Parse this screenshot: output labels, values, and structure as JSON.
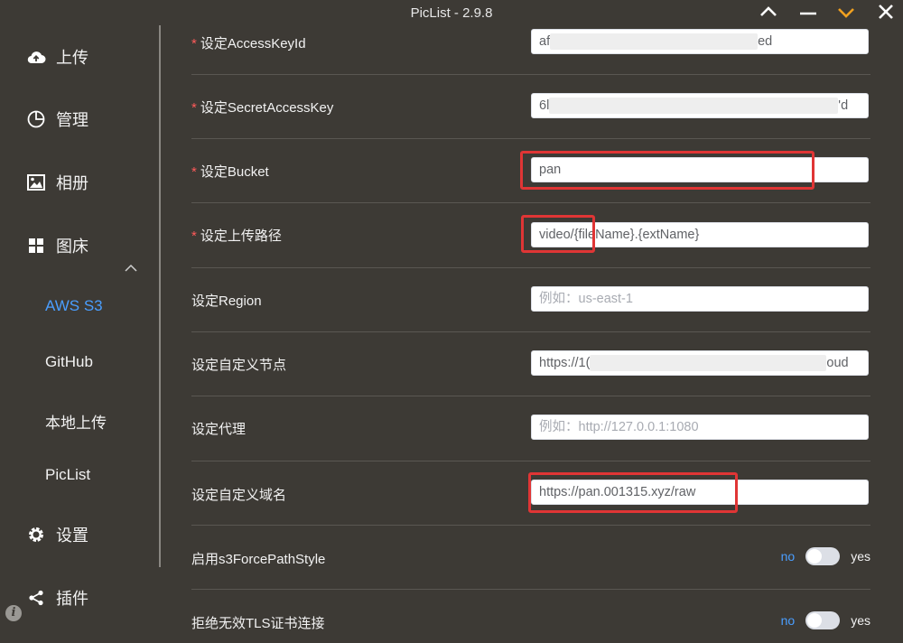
{
  "window": {
    "title": "PicList - 2.9.8",
    "accent_color": "#f0a020"
  },
  "sidebar": {
    "items": [
      {
        "label": "上传",
        "icon": "cloud-upload-icon"
      },
      {
        "label": "管理",
        "icon": "pie-chart-icon"
      },
      {
        "label": "相册",
        "icon": "image-icon"
      },
      {
        "label": "图床",
        "icon": "grid-icon"
      }
    ],
    "subitems": [
      {
        "label": "AWS S3",
        "active": true
      },
      {
        "label": "GitHub",
        "active": false
      },
      {
        "label": "本地上传",
        "active": false
      },
      {
        "label": "PicList",
        "active": false
      }
    ],
    "bottom": [
      {
        "label": "设置",
        "icon": "gear-icon"
      },
      {
        "label": "插件",
        "icon": "share-icon"
      }
    ],
    "active_color": "#4a9eff"
  },
  "form": {
    "required_marker": "*",
    "fields": [
      {
        "label": "设定AccessKeyId",
        "required": true,
        "prefix": "af",
        "suffix": "ed"
      },
      {
        "label": "设定SecretAccessKey",
        "required": true,
        "prefix": "6l",
        "suffix": "'d"
      },
      {
        "label": "设定Bucket",
        "required": true,
        "value": "pan"
      },
      {
        "label": "设定上传路径",
        "required": true,
        "value": "video/{fileName}.{extName}"
      },
      {
        "label": "设定Region",
        "required": false,
        "placeholder": "例如：us-east-1"
      },
      {
        "label": "设定自定义节点",
        "required": false,
        "prefix": "https://1(",
        "suffix": "oud"
      },
      {
        "label": "设定代理",
        "required": false,
        "placeholder": "例如：http://127.0.0.1:1080"
      },
      {
        "label": "设定自定义域名",
        "required": false,
        "value": "https://pan.001315.xyz/raw"
      }
    ],
    "toggles": [
      {
        "label": "启用s3ForcePathStyle",
        "off_label": "no",
        "on_label": "yes",
        "value": false
      },
      {
        "label": "拒绝无效TLS证书连接",
        "off_label": "no",
        "on_label": "yes",
        "value": false
      }
    ]
  }
}
